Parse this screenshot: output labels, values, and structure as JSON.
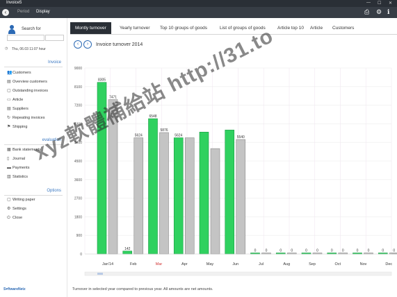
{
  "window": {
    "title": "Invoice5"
  },
  "toolbar": {
    "period_label": "Period",
    "display_label": "Display"
  },
  "sidebar": {
    "search_label": "Search for",
    "datetime": "Thu, 06.03   11:07 hour",
    "sections": {
      "invoice": "Invoice",
      "evaluation": "evaluation",
      "options": "Options"
    },
    "invoice_items": [
      {
        "label": "Customers",
        "icon": "customers-icon"
      },
      {
        "label": "Overview customers",
        "icon": "overview-icon"
      },
      {
        "label": "Outstanding invoices",
        "icon": "invoice-icon"
      },
      {
        "label": "Article",
        "icon": "article-icon"
      },
      {
        "label": "Suppliers",
        "icon": "suppliers-icon"
      },
      {
        "label": "Repeating invoices",
        "icon": "repeat-icon"
      },
      {
        "label": "Shipping",
        "icon": "shipping-icon"
      }
    ],
    "evaluation_items": [
      {
        "label": "Bank statements",
        "icon": "bank-icon"
      },
      {
        "label": "Journal",
        "icon": "journal-icon"
      },
      {
        "label": "Payments",
        "icon": "payments-icon"
      },
      {
        "label": "Statistics",
        "icon": "statistics-icon"
      }
    ],
    "options_items": [
      {
        "label": "Writing paper",
        "icon": "paper-icon"
      },
      {
        "label": "Settings",
        "icon": "settings-icon"
      },
      {
        "label": "Close",
        "icon": "close-icon"
      }
    ],
    "logo": "S♥ftwareNetz"
  },
  "tabs": [
    "Montly turnover",
    "Yearly turnover",
    "Top 10 groups of goods",
    "List of groups of goods",
    "Article top 10",
    "Article",
    "Customers"
  ],
  "chart_title": "Invoice turnover 2014",
  "footnote": "Turnover in selected year compared to previous year. All amounts are net amounts.",
  "watermark": "xyz軟體補給站 http://31.to",
  "colors": {
    "current": "#2fd15f",
    "previous": "#c4c4c4",
    "accent": "#3a78c2",
    "dark": "#2a2f36"
  },
  "chart_data": {
    "type": "bar",
    "title": "Invoice turnover 2014",
    "categories": [
      "Jan'14",
      "Feb",
      "Mar",
      "Apr",
      "May",
      "Jun",
      "Jul",
      "Aug",
      "Sep",
      "Oct",
      "Nov",
      "Dec"
    ],
    "series": [
      {
        "values": [
          8305,
          142,
          6548,
          5624,
          5900,
          6000,
          0,
          0,
          0,
          0,
          0,
          0
        ]
      },
      {
        "values": [
          7471,
          5624,
          5876,
          5624,
          5100,
          5540,
          0,
          0,
          0,
          0,
          0,
          0
        ]
      }
    ],
    "value_labels": [
      [
        "8305",
        "7471"
      ],
      [
        "142",
        "5624"
      ],
      [
        "6548",
        "5876"
      ],
      [
        "5624",
        ""
      ],
      [
        "",
        ""
      ],
      [
        "",
        "5540"
      ],
      [
        "0",
        "0"
      ],
      [
        "0",
        "0"
      ],
      [
        "0",
        "0"
      ],
      [
        "0",
        "0"
      ],
      [
        "0",
        "0"
      ],
      [
        "0",
        "0"
      ]
    ],
    "yticks": [
      "0",
      "900",
      "1800",
      "2700",
      "3600",
      "4500",
      "5400",
      "6300",
      "7200",
      "8100",
      "9000"
    ],
    "ylim": [
      0,
      9000
    ],
    "grid": true
  }
}
